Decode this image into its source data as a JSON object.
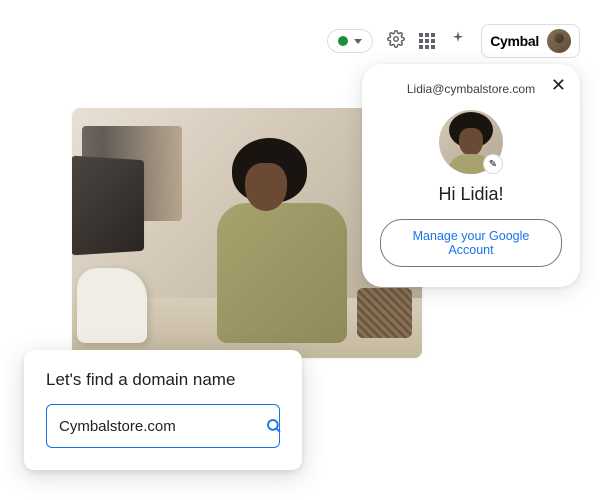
{
  "toolbar": {
    "status": "active",
    "brand_name": "Cymbal"
  },
  "account": {
    "email": "Lidia@cymbalstore.com",
    "greeting": "Hi Lidia!",
    "manage_label": "Manage your Google Account"
  },
  "domain_search": {
    "heading": "Let's find a domain name",
    "input_value": "Cymbalstore.com"
  }
}
